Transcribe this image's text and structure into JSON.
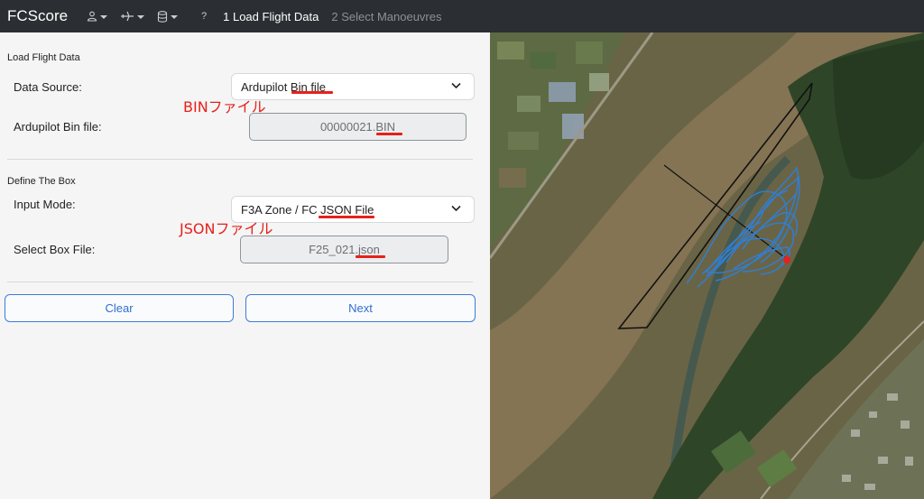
{
  "navbar": {
    "brand": "FCScore",
    "icons": [
      "user-icon",
      "plane-icon",
      "database-icon"
    ],
    "help_label": "?",
    "tabs": [
      {
        "label": "1 Load Flight Data",
        "active": true
      },
      {
        "label": "2 Select Manoeuvres",
        "active": false
      }
    ]
  },
  "load_section": {
    "title": "Load Flight Data",
    "data_source_label": "Data Source:",
    "data_source_value": "Ardupilot Bin file",
    "bin_file_label": "Ardupilot Bin file:",
    "bin_file_value": "00000021.BIN",
    "annotation": "BINファイル"
  },
  "box_section": {
    "title": "Define The Box",
    "input_mode_label": "Input Mode:",
    "input_mode_value": "F3A Zone / FC JSON File",
    "box_file_label": "Select Box File:",
    "box_file_value": "F25_021.json",
    "annotation": "JSONファイル"
  },
  "buttons": {
    "clear": "Clear",
    "next": "Next"
  },
  "colors": {
    "navbar_bg": "#2b2f33",
    "button_blue": "#2f6fcf",
    "annotation_red": "#e8201a",
    "flight_track": "#2e7fd6"
  },
  "map": {
    "description_icon": "satellite-map",
    "home_marker": "red-dot"
  }
}
